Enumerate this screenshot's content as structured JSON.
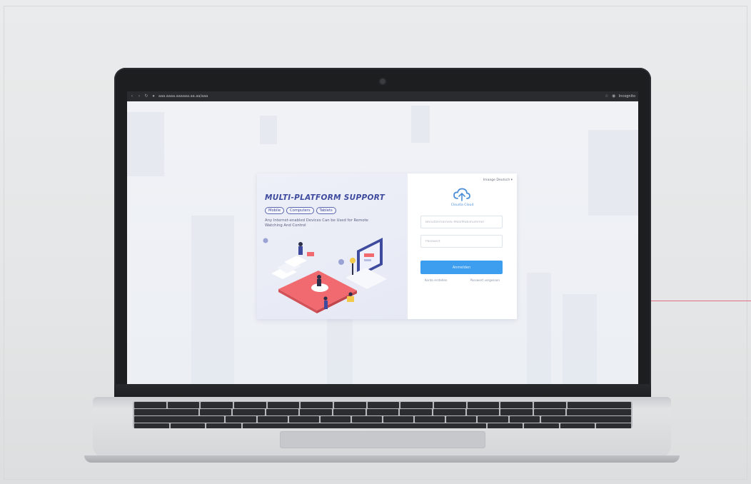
{
  "browser": {
    "url": "aaa.aaaa.aaaaaa.aa.aa/aaa",
    "profile": "Incognito"
  },
  "promo": {
    "title": "MULTI-PLATFORM SUPPORT",
    "pills": [
      "Mobile",
      "Computers",
      "Tablets"
    ],
    "description": "Any Internet-enabled Devices Can be Used for Remote Watching And Control"
  },
  "login": {
    "language": "Imaage Deutsch ▾",
    "brand": "Cloudia Cloud",
    "username_placeholder": "Benutzername/E-Mail/Mobilnummer",
    "password_placeholder": "Passwort",
    "submit_label": "Anmelden",
    "link_left": "Konto erstellen",
    "link_right": "Passwort vergessen"
  },
  "colors": {
    "accent": "#3d9ef0",
    "title": "#3e4a9e",
    "platform": "#f06a6f",
    "highlight_line": "#e0708a"
  }
}
